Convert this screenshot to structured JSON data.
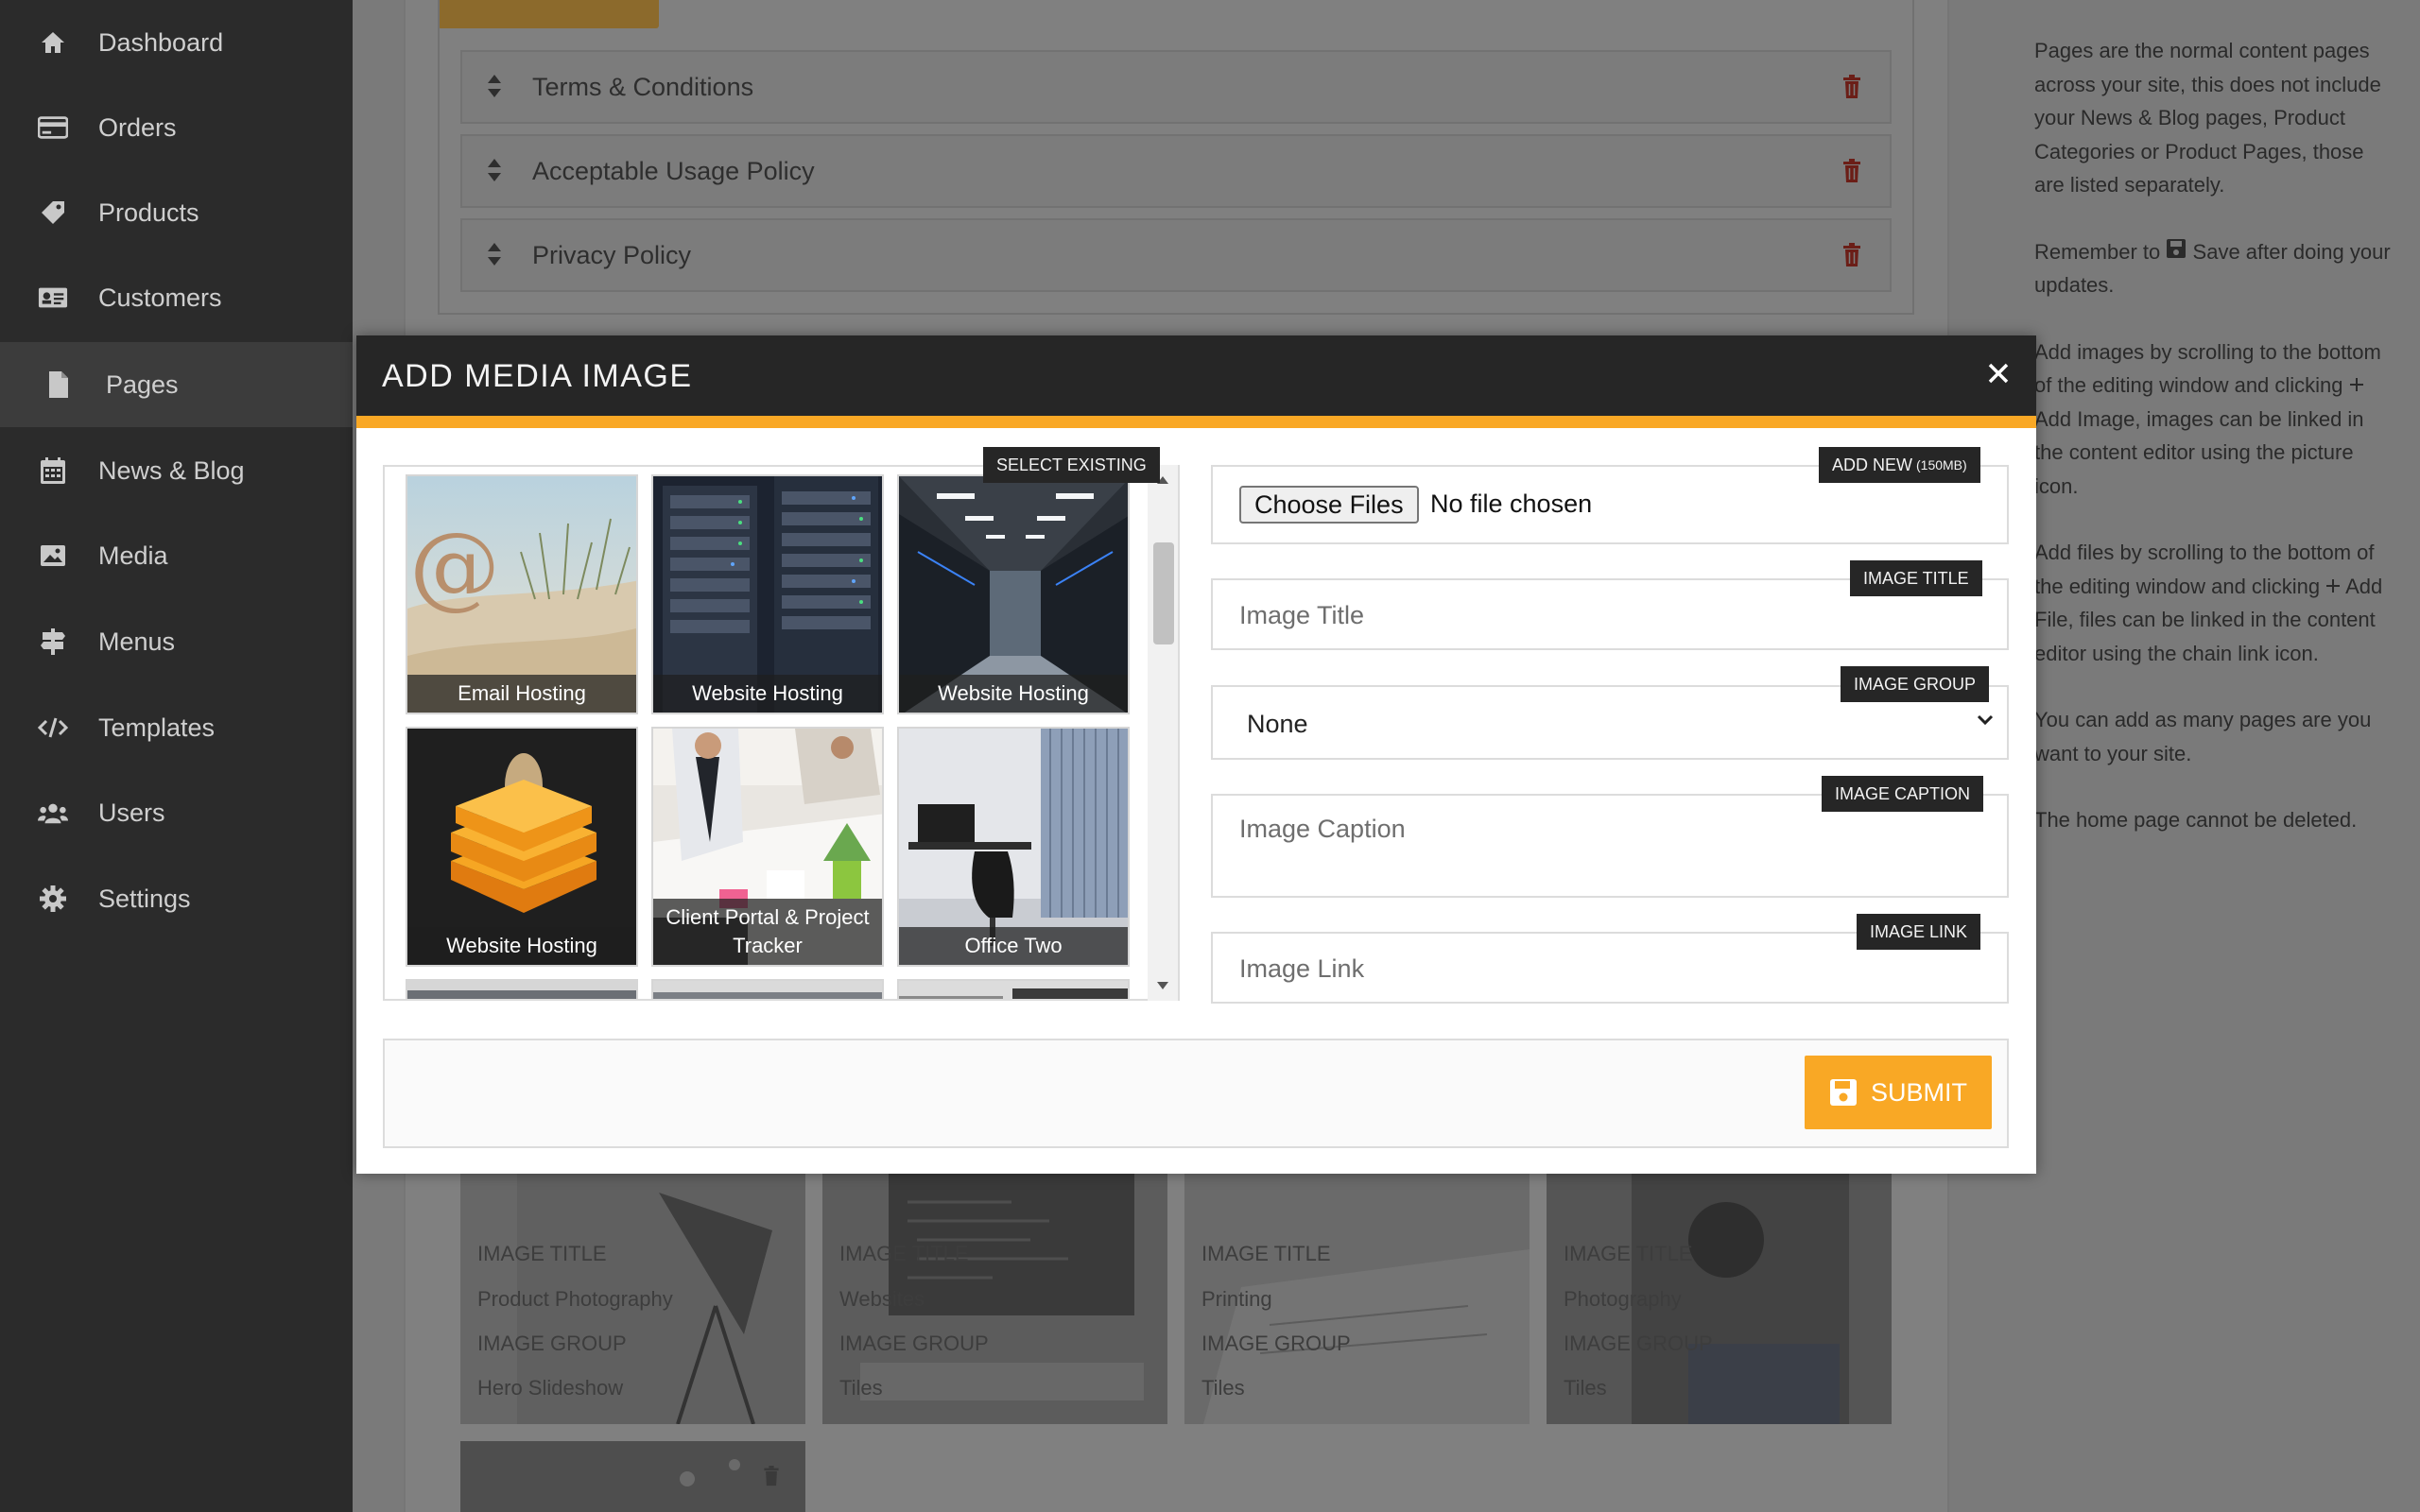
{
  "sidebar": {
    "items": [
      {
        "label": "Dashboard",
        "icon": "home-icon"
      },
      {
        "label": "Orders",
        "icon": "credit-card-icon"
      },
      {
        "label": "Products",
        "icon": "tag-icon"
      },
      {
        "label": "Customers",
        "icon": "id-card-icon"
      },
      {
        "label": "Pages",
        "icon": "file-icon",
        "active": true
      },
      {
        "label": "News & Blog",
        "icon": "calendar-icon"
      },
      {
        "label": "Media",
        "icon": "image-icon"
      },
      {
        "label": "Menus",
        "icon": "signpost-icon"
      },
      {
        "label": "Templates",
        "icon": "code-icon"
      },
      {
        "label": "Users",
        "icon": "users-icon"
      },
      {
        "label": "Settings",
        "icon": "gear-icon"
      }
    ]
  },
  "pages_list": [
    {
      "label": "Terms & Conditions"
    },
    {
      "label": "Acceptable Usage Policy"
    },
    {
      "label": "Privacy Policy"
    }
  ],
  "help": {
    "p1": "Pages are the normal content pages across your site, this does not include your News & Blog pages, Product Categories or Product Pages, those are listed separately.",
    "p2_pre": "Remember to",
    "p2_post": "Save after doing your updates.",
    "p3_pre": "Add images by scrolling to the bottom of the editing window and clicking",
    "p3_post": "Add Image, images can be linked in the content editor using the picture icon.",
    "p4_pre": "Add files by scrolling to the bottom of the editing window and clicking",
    "p4_post": "Add File, files can be linked in the content editor using the chain link icon.",
    "p5": "You can add as many pages are you want to your site.",
    "p6": "The home page cannot be deleted."
  },
  "background_tiles": [
    {
      "title_label": "IMAGE TITLE",
      "title": "Product Photography",
      "group_label": "IMAGE GROUP",
      "group": "Hero Slideshow"
    },
    {
      "title_label": "IMAGE TITLE",
      "title": "Websites",
      "group_label": "IMAGE GROUP",
      "group": "Tiles"
    },
    {
      "title_label": "IMAGE TITLE",
      "title": "Printing",
      "group_label": "IMAGE GROUP",
      "group": "Tiles"
    },
    {
      "title_label": "IMAGE TITLE",
      "title": "Photography",
      "group_label": "IMAGE GROUP",
      "group": "Tiles"
    }
  ],
  "modal": {
    "title": "ADD MEDIA IMAGE",
    "select_existing_label": "SELECT EXISTING",
    "add_new_label": "ADD NEW",
    "add_new_limit": "(150MB)",
    "choose_files_label": "Choose Files",
    "file_status": "No file chosen",
    "image_title_badge": "IMAGE TITLE",
    "image_title_placeholder": "Image Title",
    "image_group_badge": "IMAGE GROUP",
    "image_group_value": "None",
    "image_caption_badge": "IMAGE CAPTION",
    "image_caption_placeholder": "Image Caption",
    "image_link_badge": "IMAGE LINK",
    "image_link_placeholder": "Image Link",
    "submit_label": "SUBMIT",
    "thumbnails": [
      {
        "caption": "Email Hosting"
      },
      {
        "caption": "Website Hosting"
      },
      {
        "caption": "Website Hosting"
      },
      {
        "caption": "Website Hosting"
      },
      {
        "caption": "Client Portal & Project Tracker"
      },
      {
        "caption": "Office Two"
      }
    ]
  },
  "colors": {
    "accent": "#f9a825",
    "sidebar_bg": "#2b2b2b",
    "modal_header": "#262626",
    "danger": "#c0392b"
  }
}
